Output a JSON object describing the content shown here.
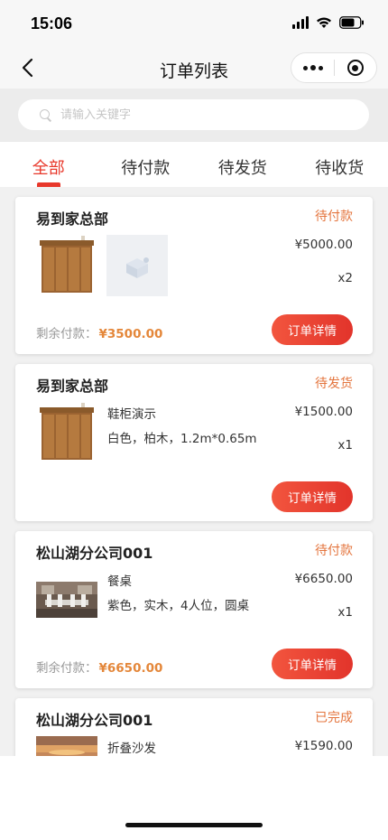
{
  "status_bar": {
    "time": "15:06"
  },
  "nav": {
    "title": "订单列表"
  },
  "search": {
    "placeholder": "请输入关键字"
  },
  "tabs": [
    {
      "label": "全部",
      "active": true
    },
    {
      "label": "待付款",
      "active": false
    },
    {
      "label": "待发货",
      "active": false
    },
    {
      "label": "待收货",
      "active": false
    }
  ],
  "orders": [
    {
      "store": "易到家总部",
      "status": "待付款",
      "items": [
        {
          "image": "wooden-cabinet"
        },
        {
          "image": "placeholder-image"
        }
      ],
      "price": "¥5000.00",
      "quantity": "x2",
      "remaining_label": "剩余付款：",
      "remaining_amount": "¥3500.00",
      "button": "订单详情"
    },
    {
      "store": "易到家总部",
      "status": "待发货",
      "items": [
        {
          "image": "wooden-cabinet"
        }
      ],
      "name": "鞋柜演示",
      "spec": "白色，柏木，1.2m*0.65m",
      "price": "¥1500.00",
      "quantity": "x1",
      "button": "订单详情"
    },
    {
      "store": "松山湖分公司001",
      "status": "待付款",
      "items": [
        {
          "image": "dining-room"
        }
      ],
      "name": "餐桌",
      "spec": "紫色，实木，4人位，圆桌",
      "price": "¥6650.00",
      "quantity": "x1",
      "remaining_label": "剩余付款：",
      "remaining_amount": "¥6650.00",
      "button": "订单详情"
    },
    {
      "store": "松山湖分公司001",
      "status": "已完成",
      "items": [
        {
          "image": "sunset-photo"
        }
      ],
      "name": "折叠沙发",
      "price": "¥1590.00"
    }
  ],
  "colors": {
    "accent": "#e8382b",
    "status_orange": "#e4753e",
    "amount_orange": "#e4873a"
  }
}
